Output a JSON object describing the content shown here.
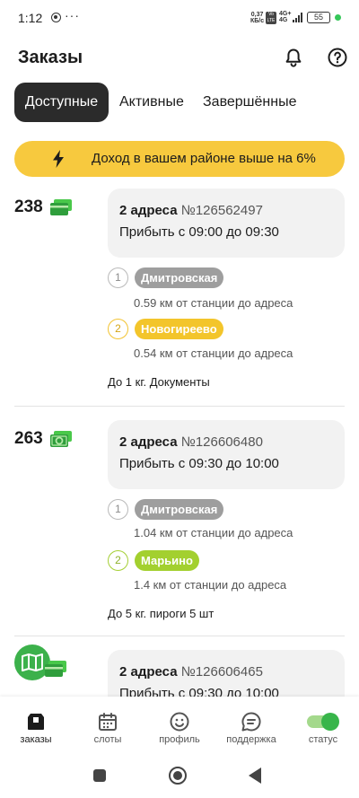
{
  "status_bar": {
    "time": "1:12",
    "dots": "···",
    "speed_value": "0,37",
    "speed_unit": "КБ/с",
    "volte": "Vo LTE",
    "network": "4G+",
    "network_sub": "4G",
    "battery": "55"
  },
  "header": {
    "title": "Заказы"
  },
  "tabs": [
    {
      "label": "Доступные",
      "active": true
    },
    {
      "label": "Активные",
      "active": false
    },
    {
      "label": "Завершённые",
      "active": false
    }
  ],
  "banner": {
    "text": "Доход в вашем районе выше на 6%"
  },
  "orders": [
    {
      "price": "238",
      "address_count": "2 адреса",
      "order_number": "№126562497",
      "time_window": "Прибыть с 09:00 до 09:30",
      "stops": [
        {
          "index": "1",
          "station": "Дмитровская",
          "distance": "0.59 км от станции до адреса"
        },
        {
          "index": "2",
          "station": "Новогиреево",
          "distance": "0.54 км от станции до адреса"
        }
      ],
      "cargo": "До 1 кг. Документы"
    },
    {
      "price": "263",
      "address_count": "2 адреса",
      "order_number": "№126606480",
      "time_window": "Прибыть с 09:30 до 10:00",
      "stops": [
        {
          "index": "1",
          "station": "Дмитровская",
          "distance": "1.04 км от станции до адреса"
        },
        {
          "index": "2",
          "station": "Марьино",
          "distance": "1.4 км от станции до адреса"
        }
      ],
      "cargo": "До 5 кг. пироги 5 шт"
    },
    {
      "address_count": "2 адреса",
      "order_number": "№126606465",
      "time_window": "Прибыть с 09:30 до 10:00"
    }
  ],
  "bottom_nav": [
    {
      "label": "заказы",
      "icon": "orders-icon",
      "active": true
    },
    {
      "label": "слоты",
      "icon": "calendar-icon",
      "active": false
    },
    {
      "label": "профиль",
      "icon": "profile-icon",
      "active": false
    },
    {
      "label": "поддержка",
      "icon": "support-icon",
      "active": false
    },
    {
      "label": "статус",
      "icon": "status-toggle",
      "active": false
    }
  ],
  "colors": {
    "accent_yellow": "#f7c93e",
    "active_tab": "#2b2b2b",
    "green": "#38b54a",
    "station_gray": "#9e9e9e",
    "station_yellow": "#f3c52b",
    "station_green": "#a3d02f"
  }
}
